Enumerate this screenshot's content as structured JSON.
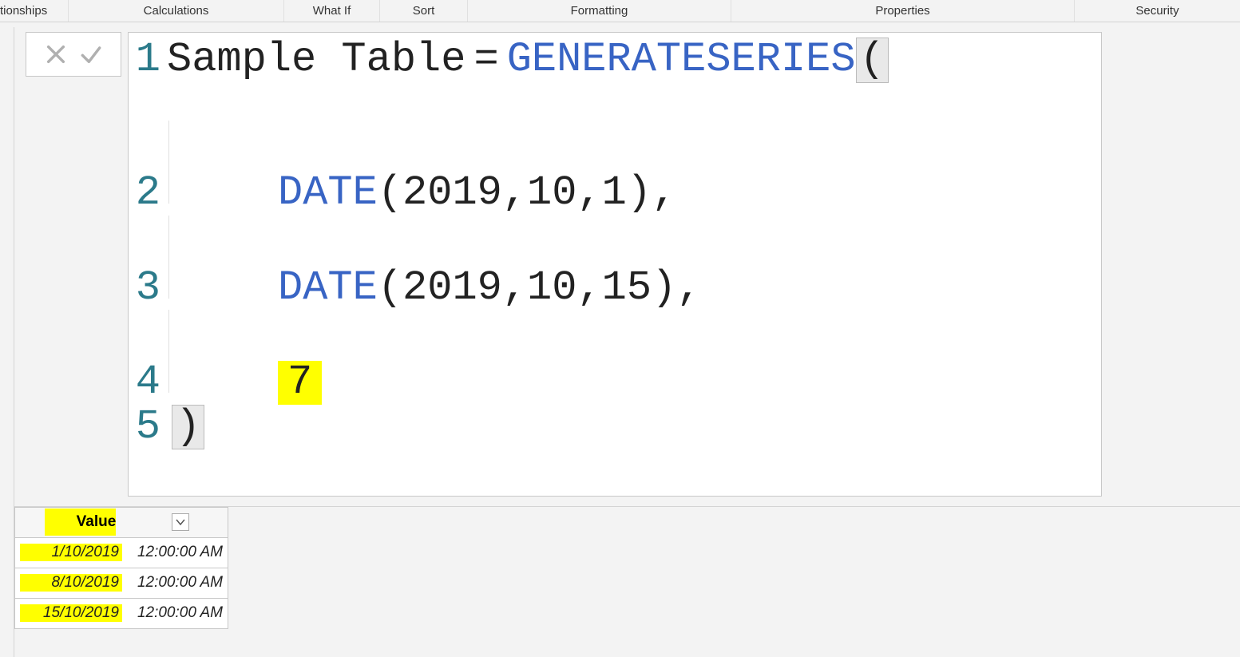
{
  "ribbon": {
    "groups": [
      "tionships",
      "Calculations",
      "What If",
      "Sort",
      "Formatting",
      "Properties",
      "Security"
    ]
  },
  "formula": {
    "line1": {
      "var": "Sample Table",
      "op": "=",
      "func": "GENERATESERIES",
      "open": "("
    },
    "line2": {
      "func": "DATE",
      "args": "(2019,10,1),",
      "indent": true
    },
    "line3": {
      "func": "DATE",
      "args": "(2019,10,15),",
      "indent": true
    },
    "line4": {
      "highlighted": "7",
      "indent": true
    },
    "line5": {
      "close": ")"
    }
  },
  "resultTable": {
    "header": "Value",
    "rows": [
      {
        "date": "1/10/2019",
        "time": "12:00:00 AM"
      },
      {
        "date": "8/10/2019",
        "time": "12:00:00 AM"
      },
      {
        "date": "15/10/2019",
        "time": "12:00:00 AM"
      }
    ]
  }
}
